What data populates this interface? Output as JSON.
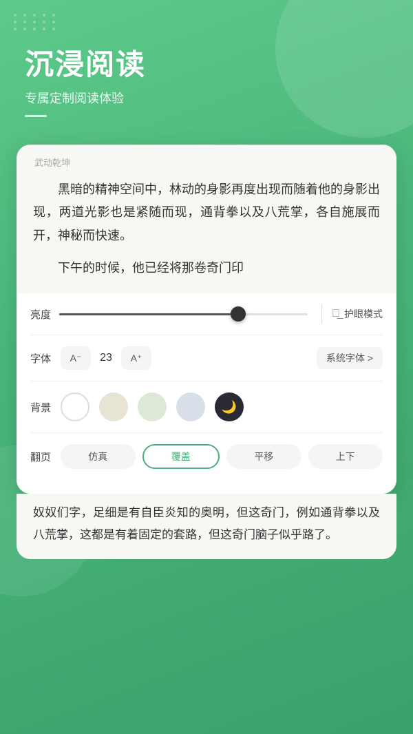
{
  "header": {
    "title": "沉浸阅读",
    "subtitle": "专属定制阅读体验"
  },
  "book": {
    "title": "武动乾坤",
    "content_p1": "　　黑暗的精神空间中，林动的身影再度出现而随着他的身影出现，两道光影也是紧随而现，通背拳以及八荒掌，各自施展而开，神秘而快速。",
    "content_p2": "　　下午的时候，他已经将那卷奇门印"
  },
  "settings": {
    "brightness_label": "亮度",
    "eye_mode_label": "护眼模式",
    "font_label": "字体",
    "font_decrease": "A⁻",
    "font_size": "23",
    "font_increase": "A⁺",
    "font_family": "系统字体 >",
    "bg_label": "背景",
    "pageturn_label": "翻页",
    "pageturn_options": [
      "仿真",
      "覆盖",
      "平移",
      "上下"
    ],
    "pageturn_active": "覆盖"
  },
  "bottom_content": {
    "text": "奴奴们字，足细是有自臣炎知的奥明，但这奇门，例如通背拳以及八荒掌，这都是有着固定的套路，但这奇门脑子似乎路了。"
  },
  "colors": {
    "green": "#4caf7d",
    "accent": "#4caf7d"
  }
}
